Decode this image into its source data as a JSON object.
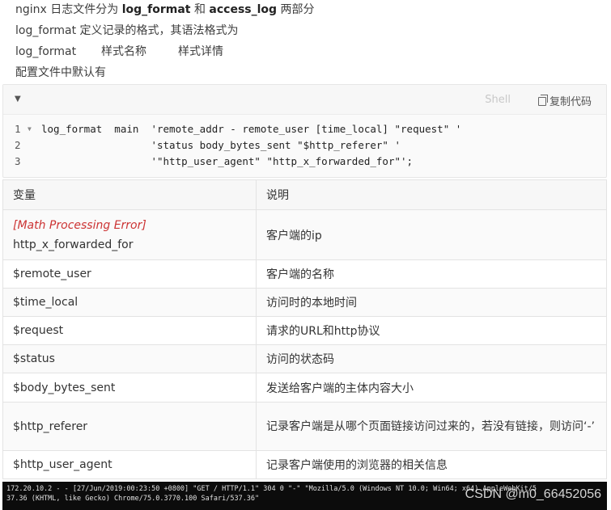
{
  "intro": {
    "line1_prefix": "nginx 日志文件分为 ",
    "line1_term1": "log_format",
    "line1_mid": " 和 ",
    "line1_term2": "access_log",
    "line1_suffix": " 两部分",
    "line2": "log_format 定义记录的格式，其语法格式为",
    "line3": [
      "log_format",
      "样式名称",
      "样式详情"
    ],
    "line4": "配置文件中默认有"
  },
  "code_block": {
    "language": "Shell",
    "copy_label": "复制代码",
    "lines": [
      {
        "n": "1",
        "text": "log_format  main  'remote_addr - remote_user [time_local] \"request\" '"
      },
      {
        "n": "2",
        "text": "                  'status body_bytes_sent \"$http_referer\" '"
      },
      {
        "n": "3",
        "text": "                  '\"http_user_agent\" \"http_x_forwarded_for\"';"
      }
    ]
  },
  "table": {
    "headers": [
      "变量",
      "说明"
    ],
    "row0_error": "[Math Processing Error]",
    "rows": [
      {
        "var": "http_x_forwarded_for",
        "desc": "客户端的ip"
      },
      {
        "var": "$remote_user",
        "desc": "客户端的名称"
      },
      {
        "var": "$time_local",
        "desc": "访问时的本地时间"
      },
      {
        "var": "$request",
        "desc": "请求的URL和http协议"
      },
      {
        "var": "$status",
        "desc": "访问的状态码"
      },
      {
        "var": "$body_bytes_sent",
        "desc": "发送给客户端的主体内容大小"
      },
      {
        "var": "$http_referer",
        "desc": "记录客户端是从哪个页面链接访问过来的，若没有链接，则访问‘-’"
      },
      {
        "var": "$http_user_agent",
        "desc": "记录客户端使用的浏览器的相关信息"
      }
    ]
  },
  "terminal": {
    "line1": "172.20.10.2 - - [27/Jun/2019:00:23:50 +0800] \"GET / HTTP/1.1\" 304 0 \"-\" \"Mozilla/5.0 (Windows NT 10.0; Win64; x64) AppleWebKit/5",
    "line2": "37.36 (KHTML, like Gecko) Chrome/75.0.3770.100 Safari/537.36\""
  },
  "watermark": "CSDN @m0_66452056"
}
